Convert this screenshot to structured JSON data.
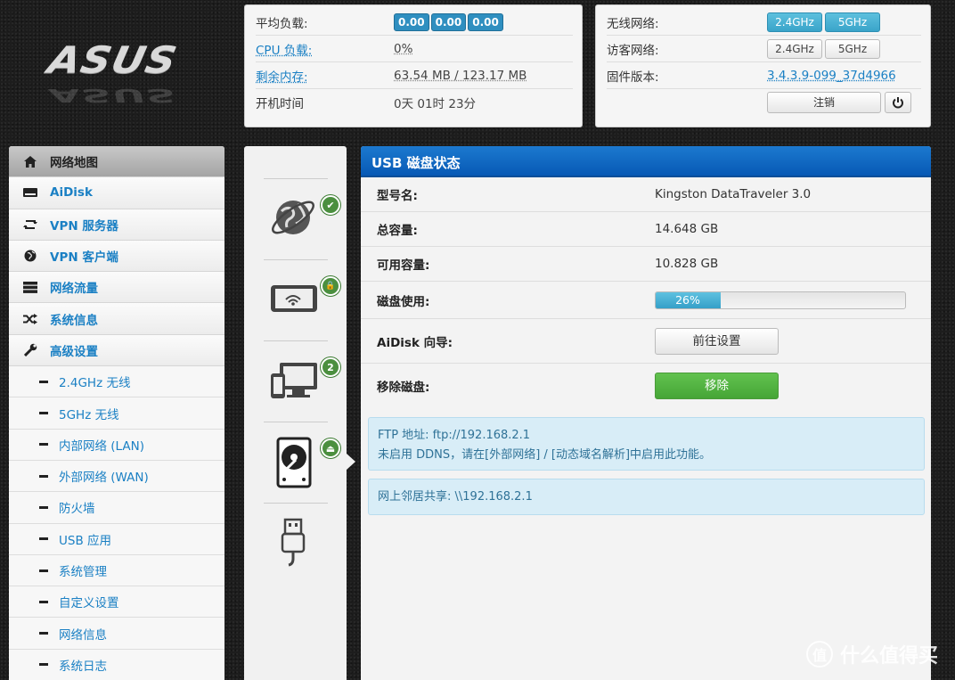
{
  "brand": {
    "logo_text": "ASUS"
  },
  "status_box": {
    "rows": [
      {
        "label": "平均负载:",
        "badges": [
          "0.00",
          "0.00",
          "0.00"
        ]
      },
      {
        "label": "CPU 负载:",
        "value": "0%"
      },
      {
        "label": "剩余内存:",
        "value": "63.54 MB / 123.17 MB"
      },
      {
        "label": "开机时间",
        "value": "0天 01时 23分"
      }
    ]
  },
  "wifi_box": {
    "wireless_label": "无线网络:",
    "guest_label": "访客网络:",
    "firmware_label": "固件版本:",
    "firmware_value": "3.4.3.9-099_37d4966",
    "band_24": "2.4GHz",
    "band_5": "5GHz",
    "logout_label": "注销",
    "colors": {
      "band_on": "#3aa4c9"
    }
  },
  "menu": {
    "main_items": [
      {
        "label": "网络地图",
        "icon": "home-icon",
        "active": true
      },
      {
        "label": "AiDisk",
        "icon": "disk-icon",
        "active": false
      },
      {
        "label": "VPN 服务器",
        "icon": "vpn-server-icon",
        "active": false
      },
      {
        "label": "VPN 客户端",
        "icon": "globe-icon",
        "active": false
      },
      {
        "label": "网络流量",
        "icon": "traffic-icon",
        "active": false
      },
      {
        "label": "系统信息",
        "icon": "shuffle-icon",
        "active": false
      },
      {
        "label": "高级设置",
        "icon": "wrench-icon",
        "active": false
      }
    ],
    "sub_items": [
      "2.4GHz 无线",
      "5GHz 无线",
      "内部网络 (LAN)",
      "外部网络 (WAN)",
      "防火墙",
      "USB 应用",
      "系统管理",
      "自定义设置",
      "网络信息",
      "系统日志"
    ]
  },
  "icon_column": {
    "items": [
      {
        "name": "internet-globe-icon",
        "badge": "✔"
      },
      {
        "name": "wireless-device-icon",
        "badge": "🔒"
      },
      {
        "name": "clients-icon",
        "badge": "2"
      },
      {
        "name": "hard-disk-icon",
        "badge": "⏏"
      },
      {
        "name": "usb-icon",
        "badge": ""
      }
    ]
  },
  "usb_panel": {
    "title": "USB 磁盘状态",
    "model_label": "型号名:",
    "model_value": "Kingston DataTraveler 3.0",
    "total_label": "总容量:",
    "total_value": "14.648 GB",
    "free_label": "可用容量:",
    "free_value": "10.828 GB",
    "usage_label": "磁盘使用:",
    "usage_percent": 26,
    "usage_text": "26%",
    "aidisk_label": "AiDisk 向导:",
    "aidisk_button": "前往设置",
    "remove_label": "移除磁盘:",
    "remove_button": "移除",
    "ftp_line1": "FTP 地址: ftp://192.168.2.1",
    "ftp_line2": "未启用 DDNS，请在[外部网络] / [动态域名解析]中启用此功能。",
    "samba_line": "网上邻居共享: \\\\192.168.2.1"
  },
  "watermark": {
    "text": "什么值得买",
    "symbol": "值"
  }
}
